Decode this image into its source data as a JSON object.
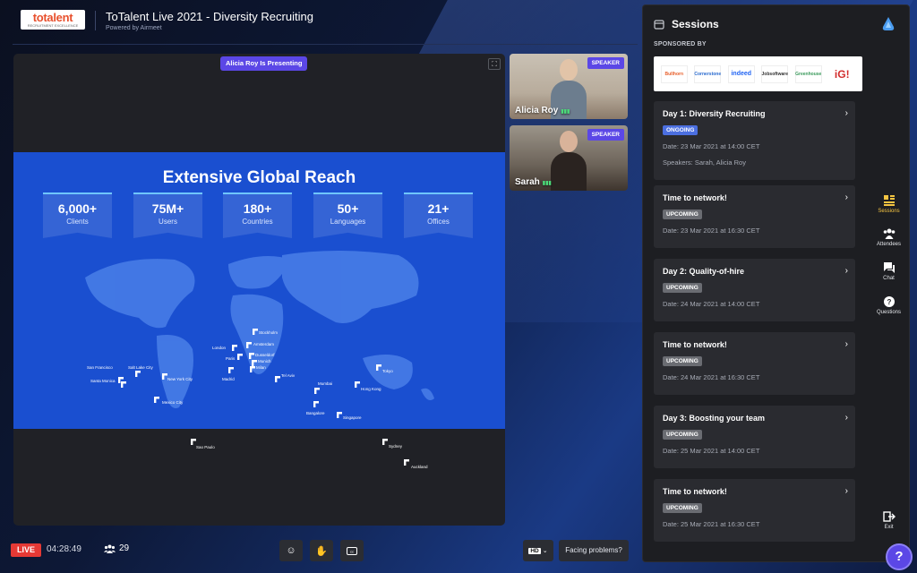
{
  "header": {
    "logo_text": "totalent",
    "logo_sub": "RECRUITMENT EXCELLENCE",
    "event_title": "ToTalent Live 2021 - Diversity Recruiting",
    "powered_by": "Powered by Airmeet"
  },
  "stage": {
    "presenting_label": "Alicia Roy Is Presenting",
    "slide": {
      "title": "Extensive Global Reach",
      "stats": [
        {
          "value": "6,000+",
          "label": "Clients"
        },
        {
          "value": "75M+",
          "label": "Users"
        },
        {
          "value": "180+",
          "label": "Countries"
        },
        {
          "value": "50+",
          "label": "Languages"
        },
        {
          "value": "21+",
          "label": "Offices"
        }
      ],
      "cities": {
        "san_francisco": "San Francisco",
        "salt_lake_city": "Salt Lake City",
        "santa_monica": "Santa Monica",
        "new_york_city": "New York City",
        "mexico_city": "Mexico City",
        "sao_paulo": "Sao Paulo",
        "london": "London",
        "paris": "Paris",
        "madrid": "Madrid",
        "stockholm": "Stockholm",
        "amsterdam": "Amsterdam",
        "dusseldorf": "Dusseldorf",
        "munich": "Munich",
        "milan": "Milan",
        "tel_aviv": "Tel Aviv",
        "mumbai": "Mumbai",
        "bangalore": "Bangalore",
        "singapore": "Singapore",
        "hong_kong": "Hong Kong",
        "tokyo": "Tokyo",
        "sydney": "Sydney",
        "auckland": "Auckland"
      }
    }
  },
  "speakers": [
    {
      "name": "Alicia Roy",
      "badge": "SPEAKER"
    },
    {
      "name": "Sarah",
      "badge": "SPEAKER"
    }
  ],
  "bottom_bar": {
    "live_label": "LIVE",
    "timer": "04:28:49",
    "attendee_count": "29",
    "hd_label": "HD",
    "facing_problems": "Facing problems?"
  },
  "sessions_panel": {
    "title": "Sessions",
    "sponsored_by": "SPONSORED BY",
    "sponsors": [
      "Bullhorn",
      "Cornerstone",
      "indeed",
      "Jobsoftware",
      "Greenhouse",
      "iG!"
    ],
    "sessions": [
      {
        "title": "Day 1: Diversity Recruiting",
        "status": "ONGOING",
        "date": "Date: 23 Mar 2021 at 14:00 CET",
        "speakers": "Speakers: Sarah, Alicia Roy"
      },
      {
        "title": "Time to network!",
        "status": "UPCOMING",
        "date": "Date: 23 Mar 2021 at 16:30 CET"
      },
      {
        "title": "Day 2: Quality-of-hire",
        "status": "UPCOMING",
        "date": "Date: 24 Mar 2021 at 14:00 CET"
      },
      {
        "title": "Time to network!",
        "status": "UPCOMING",
        "date": "Date: 24 Mar 2021 at 16:30 CET"
      },
      {
        "title": "Day 3: Boosting your team",
        "status": "UPCOMING",
        "date": "Date: 25 Mar 2021 at 14:00 CET"
      },
      {
        "title": "Time to network!",
        "status": "UPCOMING",
        "date": "Date: 25 Mar 2021 at 16:30 CET"
      }
    ]
  },
  "rail": {
    "sessions": "Sessions",
    "attendees": "Attendees",
    "chat": "Chat",
    "questions": "Questions",
    "exit": "Exit"
  },
  "colors": {
    "accent": "#5b47e6",
    "live": "#e53935",
    "slide_bg": "#1a4fd0",
    "ongoing": "#4b6fe0",
    "upcoming": "#6a6c72",
    "active_rail": "#f5c542"
  },
  "icons": {
    "expand": "expand-icon",
    "emoji": "emoji-icon",
    "hand": "raise-hand-icon",
    "cc": "closed-captions-icon",
    "chevron": "chevron-right-icon",
    "help": "help-icon"
  }
}
